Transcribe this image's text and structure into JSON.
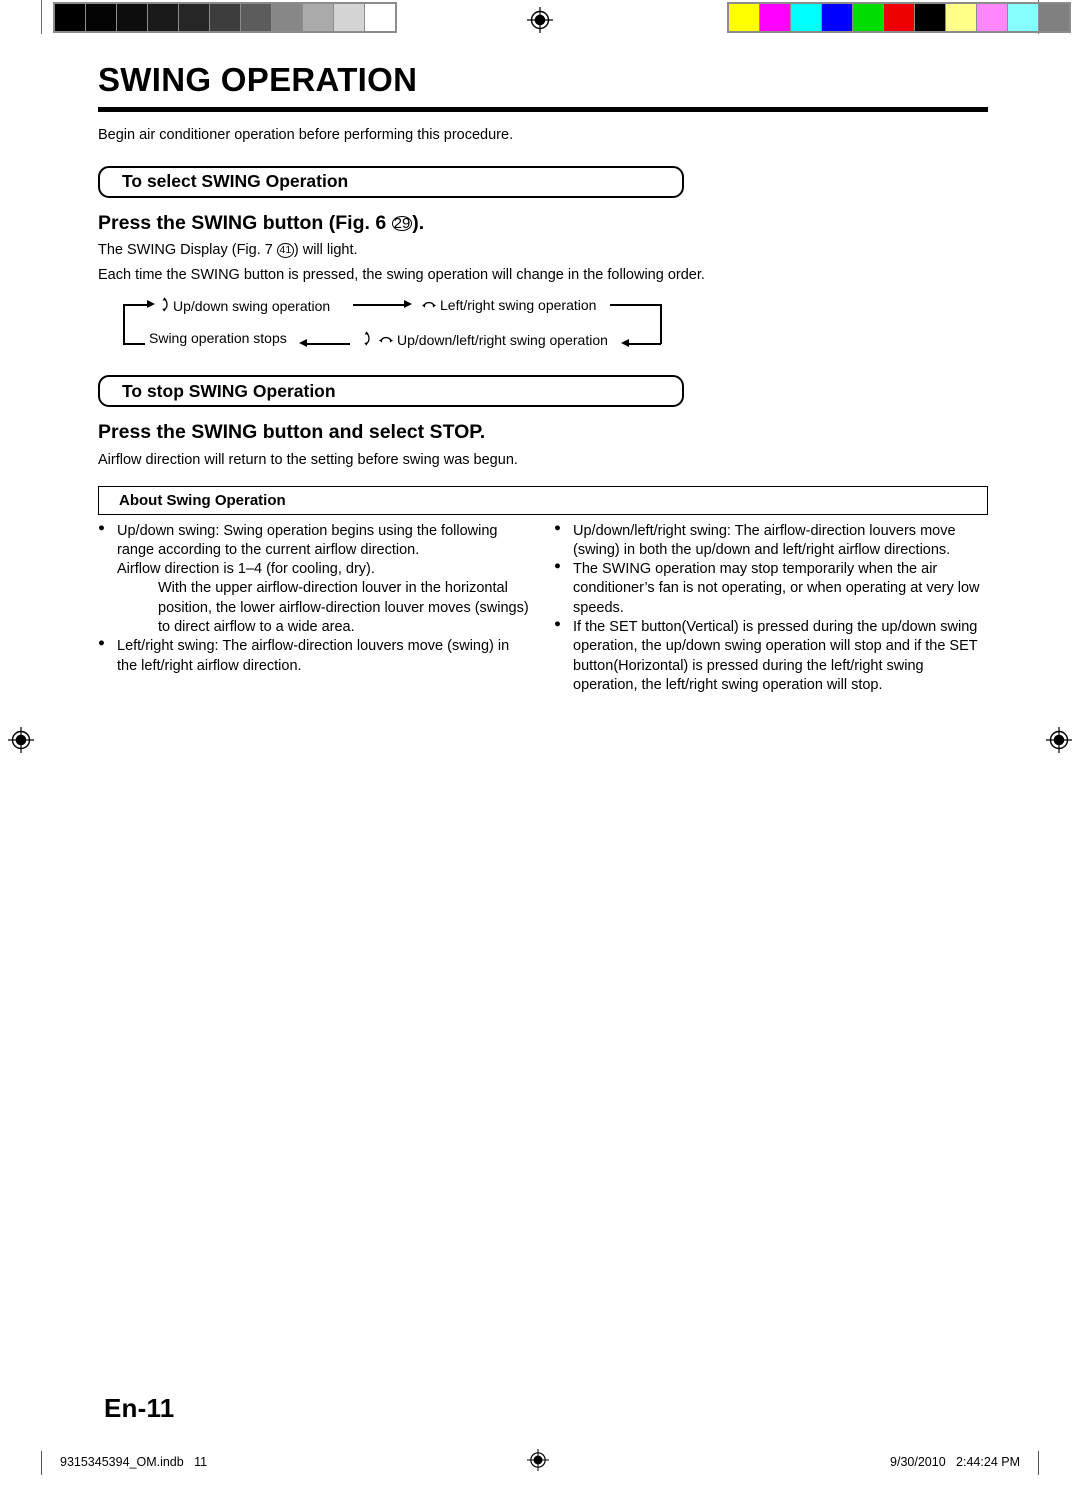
{
  "document": {
    "chapter_title": "SWING OPERATION",
    "intro": "Begin air conditioner operation before performing this procedure.",
    "page_number": "En-11"
  },
  "select_section": {
    "pill_label": "To select SWING Operation",
    "step_heading_prefix": "Press the SWING button (Fig. 6 ",
    "step_heading_ref": "29",
    "step_heading_suffix": ").",
    "display_line_prefix": "The SWING Display (Fig. 7 ",
    "display_line_ref": "41",
    "display_line_suffix": ") will light.",
    "order_line": "Each time the SWING button is pressed, the swing operation will change in the following order."
  },
  "flow_diagram": {
    "updown_icon": "updown-swing-icon",
    "leftright_icon": "leftright-swing-icon",
    "step_1": "Up/down swing operation",
    "step_2": "Left/right swing operation",
    "step_3": "Up/down/left/right swing operation",
    "step_4": "Swing operation stops"
  },
  "stop_section": {
    "pill_label": "To stop SWING Operation",
    "step_heading": "Press the SWING button and select STOP.",
    "body_line": "Airflow direction will return to the setting before swing was begun."
  },
  "about_section": {
    "box_label": "About Swing Operation",
    "left_column": [
      {
        "lines": [
          "Up/down swing: Swing operation begins using the following range according to the current airflow direction.",
          "Airflow direction is 1–4 (for cooling, dry)."
        ],
        "indented": "With the upper airflow-direction louver in the horizontal position, the lower airflow-direction louver moves (swings) to direct airflow to a wide area."
      },
      {
        "lines": [
          "Left/right swing: The airflow-direction louvers move (swing) in the left/right airflow direction."
        ],
        "indented": ""
      }
    ],
    "right_column": [
      {
        "lines": [
          "Up/down/left/right swing: The airflow-direction louvers move (swing) in both the up/down and left/right airflow directions."
        ],
        "indented": ""
      },
      {
        "lines": [
          "The SWING operation may stop temporarily when the air conditioner’s fan is not operating, or when operating at very low speeds."
        ],
        "indented": ""
      },
      {
        "lines": [
          "If the SET button(Vertical) is pressed during the up/down swing operation, the up/down swing operation will stop and if the SET button(Horizontal) is pressed during the left/right swing operation, the left/right swing operation will stop."
        ],
        "indented": ""
      }
    ]
  },
  "footer": {
    "file_label": "9315345394_OM.indb   11",
    "timestamp": "9/30/2010   2:44:24 PM"
  },
  "calibration": {
    "grayscale_patches": [
      "#000000",
      "#040404",
      "#0d0d0d",
      "#1a1a1a",
      "#262626",
      "#3d3d3d",
      "#5c5c5c",
      "#878787",
      "#aaaaaa",
      "#d4d4d4",
      "#ffffff"
    ],
    "color_patches": [
      "#ffff00",
      "#ff00ff",
      "#00ffff",
      "#0000ff",
      "#00dd00",
      "#ee0000",
      "#000000",
      "#ffff88",
      "#ff88ff",
      "#88ffff",
      "#808080"
    ]
  }
}
